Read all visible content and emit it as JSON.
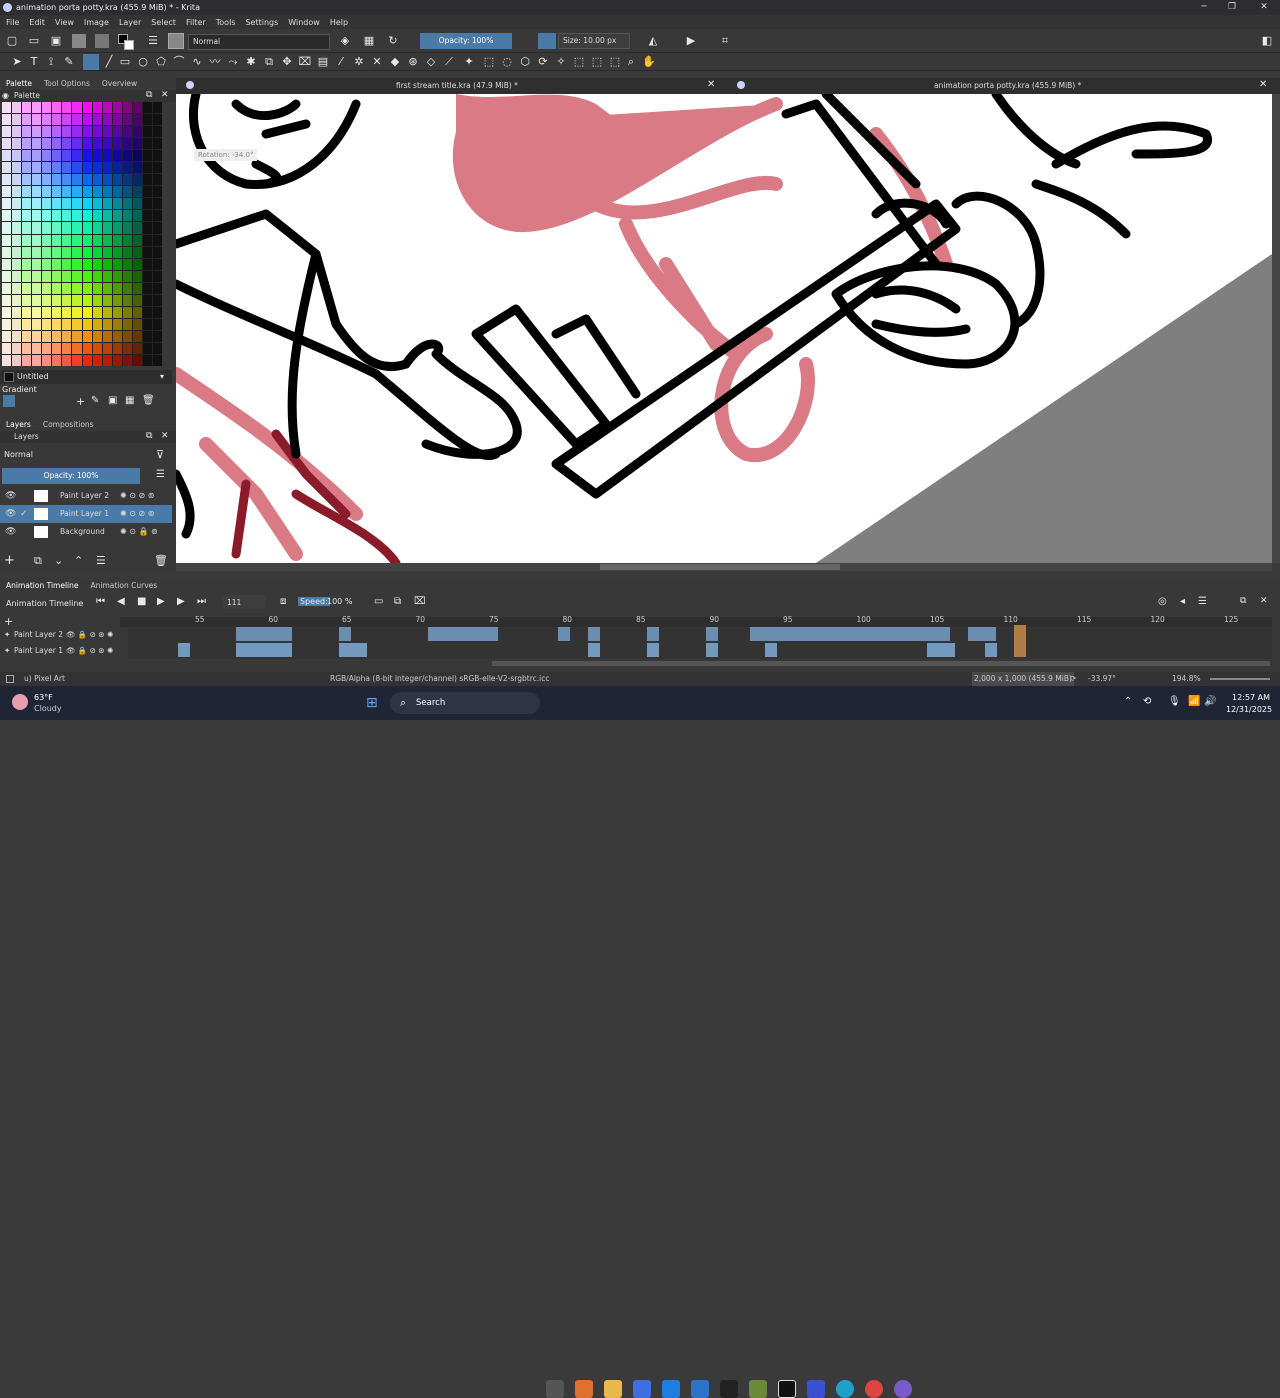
{
  "window": {
    "title": "animation porta potty.kra (455.9 MiB) * - Krita",
    "minimize": "─",
    "maximize": "❐",
    "close": "✕"
  },
  "menu": [
    "File",
    "Edit",
    "View",
    "Image",
    "Layer",
    "Select",
    "Filter",
    "Tools",
    "Settings",
    "Window",
    "Help"
  ],
  "toolbar": {
    "blend_mode": "Normal",
    "opacity": "Opacity: 100%",
    "size": "Size: 10.00 px"
  },
  "left_tabs": [
    "Palette",
    "Tool Options",
    "Overview"
  ],
  "palette_header": "Palette",
  "palette_name": "Untitled",
  "gradient_label": "Gradient",
  "layer_tabs": [
    "Layers",
    "Compositions"
  ],
  "layers_header": "Layers",
  "layers_blend": "Normal",
  "layers_opacity": "Opacity: 100%",
  "layers": [
    {
      "name": "Paint Layer 2",
      "selected": false
    },
    {
      "name": "Paint Layer 1",
      "selected": true
    },
    {
      "name": "Background",
      "selected": false
    }
  ],
  "doc_tabs": [
    {
      "title": "first stream title.kra (47.9 MiB) *"
    },
    {
      "title": "animation porta potty.kra (455.9 MiB) *"
    }
  ],
  "canvas": {
    "rotation_label": "Rotation: -34.0°"
  },
  "timeline": {
    "tabs": [
      "Animation Timeline",
      "Animation Curves"
    ],
    "header": "Animation Timeline",
    "frame": "111",
    "speed_label": "Speed:",
    "speed": "100 %",
    "ruler": [
      "55",
      "60",
      "65",
      "70",
      "75",
      "80",
      "85",
      "90",
      "95",
      "100",
      "105",
      "110",
      "115",
      "120",
      "125"
    ],
    "tracks": [
      "Paint Layer 2",
      "Paint Layer 1"
    ]
  },
  "status": {
    "tool": "u) Pixel Art",
    "color_info": "RGB/Alpha (8-bit integer/channel)  sRGB-elle-V2-srgbtrc.icc",
    "dims": "2,000 x 1,000 (455.9 MiB)",
    "rotation": "-33.97°",
    "zoom": "194.8%"
  },
  "taskbar": {
    "weather_temp": "63°F",
    "weather_desc": "Cloudy",
    "search": "Search",
    "time": "12:57 AM",
    "date": "12/31/2025"
  },
  "colors": {
    "accent": "#4a7aa8",
    "pink": "#d97a85",
    "black": "#000000"
  }
}
